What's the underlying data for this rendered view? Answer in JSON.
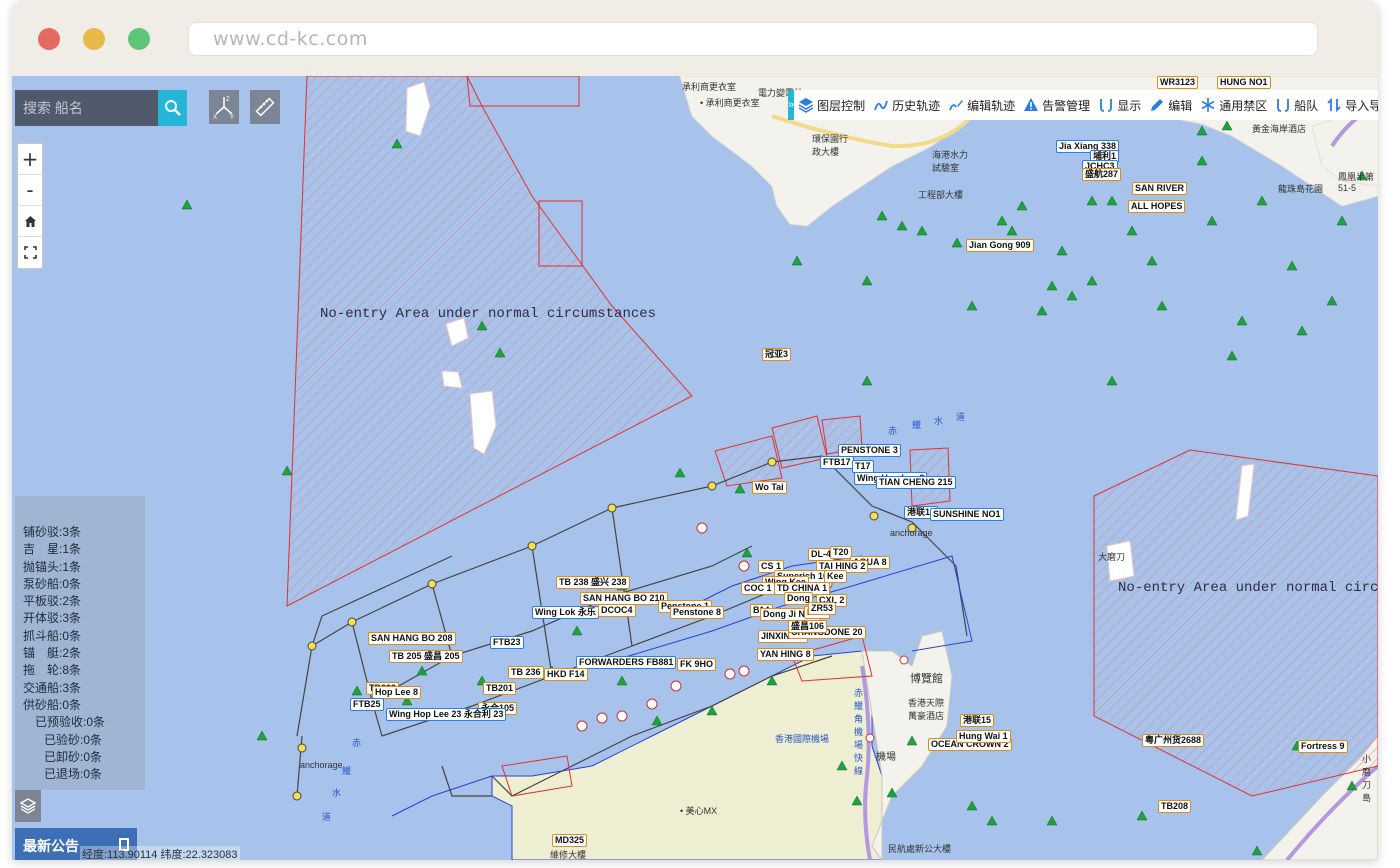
{
  "browser": {
    "url": "www.cd-kc.com"
  },
  "search": {
    "placeholder": "搜索 船名"
  },
  "toolbar": {
    "toggle": "»",
    "items": [
      {
        "label": "图层控制",
        "icon": "layers-icon"
      },
      {
        "label": "历史轨迹",
        "icon": "track-icon"
      },
      {
        "label": "编辑轨迹",
        "icon": "edit-track-icon"
      },
      {
        "label": "告警管理",
        "icon": "warning-icon"
      },
      {
        "label": "显示",
        "icon": "display-icon"
      },
      {
        "label": "编辑",
        "icon": "pencil-icon"
      },
      {
        "label": "通用禁区",
        "icon": "snowflake-icon"
      },
      {
        "label": "船队",
        "icon": "fleet-icon"
      },
      {
        "label": "导入导出",
        "icon": "import-export-icon"
      }
    ]
  },
  "zoom": {
    "plus": "+",
    "minus": "-"
  },
  "stats": [
    {
      "text": "铺砂驳:3条",
      "level": 0
    },
    {
      "text": "吉　星:1条",
      "level": 0
    },
    {
      "text": "抛锚头:1条",
      "level": 0
    },
    {
      "text": "泵砂船:0条",
      "level": 0
    },
    {
      "text": "平板驳:2条",
      "level": 0
    },
    {
      "text": "开体驳:3条",
      "level": 0
    },
    {
      "text": "抓斗船:0条",
      "level": 0
    },
    {
      "text": "锚　艇:2条",
      "level": 0
    },
    {
      "text": "拖　轮:8条",
      "level": 0
    },
    {
      "text": "交通船:3条",
      "level": 0
    },
    {
      "text": "供砂船:0条",
      "level": 0
    },
    {
      "text": "已预验收:0条",
      "level": 1
    },
    {
      "text": "已验砂:0条",
      "level": 2
    },
    {
      "text": "已卸砂:0条",
      "level": 2
    },
    {
      "text": "已退场:0条",
      "level": 2
    }
  ],
  "notice": {
    "label": "最新公告"
  },
  "coords": {
    "text": "经度:113.90114 纬度:22.323083"
  },
  "areas": {
    "left_title": "No-entry Area under normal circumstances",
    "right_title": "No-entry Area under normal circumstanc"
  },
  "land_labels": [
    "承利商更衣室",
    "• 承利商更衣室",
    "電力變電站",
    "環保園行政大樓",
    "海港水力試驗室",
    "工程部大樓",
    "黃金海岸酒店",
    "龍珠島花園",
    "鳳凰半第51-5",
    "香港國際機場",
    "博覽館",
    "香港天際萬豪酒店",
    "機場",
    "• 美心MX",
    "維修大樓",
    "民航處新公大樓",
    "赤鱲角機場快線",
    "大磨刀",
    "小磨刀島",
    "赤",
    "鱲",
    "水",
    "道",
    "赤",
    "鱲",
    "水",
    "道",
    "anchorage",
    "anchorage"
  ],
  "ships": [
    {
      "name": "Jia Xiang 338",
      "color": "#2a7de1"
    },
    {
      "name": "埔利1",
      "color": "#2a7de1"
    },
    {
      "name": "JCHC3",
      "color": "#2a7de1"
    },
    {
      "name": "盛航287",
      "color": "#e08a17"
    },
    {
      "name": "SAN RIVER",
      "color": "#e08a17"
    },
    {
      "name": "ALL HOPES",
      "color": "#e08a17"
    },
    {
      "name": "Jian Gong 909",
      "color": "#e08a17"
    },
    {
      "name": "冠亚3",
      "color": "#e08a17"
    },
    {
      "name": "PENSTONE 3",
      "color": "#2a7de1"
    },
    {
      "name": "FTB17",
      "color": "#2a7de1"
    },
    {
      "name": "T17",
      "color": "#2a7de1"
    },
    {
      "name": "Wing Hop Lee 8",
      "color": "#2a7de1"
    },
    {
      "name": "TIAN CHENG 215",
      "color": "#2a7de1"
    },
    {
      "name": "Wo Tai",
      "color": "#e08a17"
    },
    {
      "name": "港联10",
      "color": "#2a7de1"
    },
    {
      "name": "SUNSHINE NO1",
      "color": "#2a7de1"
    },
    {
      "name": "DL-4",
      "color": "#e08a17"
    },
    {
      "name": "T20",
      "color": "#e08a17"
    },
    {
      "name": "AQUA 8",
      "color": "#e08a17"
    },
    {
      "name": "TAI HING 2",
      "color": "#e08a17"
    },
    {
      "name": "CS 1",
      "color": "#e08a17"
    },
    {
      "name": "Superich 10",
      "color": "#e08a17"
    },
    {
      "name": "Wing Kee",
      "color": "#e08a17"
    },
    {
      "name": "Kee",
      "color": "#e08a17"
    },
    {
      "name": "COC 1",
      "color": "#e08a17"
    },
    {
      "name": "TD CHINA 1",
      "color": "#e08a17"
    },
    {
      "name": "Dong",
      "color": "#e08a17"
    },
    {
      "name": "CXL 2",
      "color": "#e08a17"
    },
    {
      "name": "B14",
      "color": "#e08a17"
    },
    {
      "name": "Dong Ji No.5",
      "color": "#e08a17"
    },
    {
      "name": "No.7",
      "color": "#e08a17"
    },
    {
      "name": "ZR53",
      "color": "#e08a17"
    },
    {
      "name": "TB 238 盛兴 238",
      "color": "#e08a17"
    },
    {
      "name": "SAN HANG BO 210",
      "color": "#e08a17"
    },
    {
      "name": "Wing Lok 永乐",
      "color": "#2a7de1"
    },
    {
      "name": "DCOC4",
      "color": "#e08a17"
    },
    {
      "name": "Penstone 1",
      "color": "#e08a17"
    },
    {
      "name": "Penstone 8",
      "color": "#e08a17"
    },
    {
      "name": "JINXIN707",
      "color": "#e08a17"
    },
    {
      "name": "CHANGDONE 20",
      "color": "#e08a17"
    },
    {
      "name": "盛昌106",
      "color": "#e08a17"
    },
    {
      "name": "SAN HANG BO 208",
      "color": "#e08a17"
    },
    {
      "name": "TB 205 盛昌 205",
      "color": "#e08a17"
    },
    {
      "name": "FTB23",
      "color": "#2a7de1"
    },
    {
      "name": "YAN HING 8",
      "color": "#e08a17"
    },
    {
      "name": "FORWARDERS FB881",
      "color": "#2a7de1"
    },
    {
      "name": "FK 9HO",
      "color": "#e08a17"
    },
    {
      "name": "TB 236",
      "color": "#e08a17"
    },
    {
      "name": "HKD F14",
      "color": "#e08a17"
    },
    {
      "name": "TB233",
      "color": "#e08a17"
    },
    {
      "name": "TB201",
      "color": "#e08a17"
    },
    {
      "name": "Hop Lee 8",
      "color": "#e08a17"
    },
    {
      "name": "FTB25",
      "color": "#2a7de1"
    },
    {
      "name": "永合105",
      "color": "#e08a17"
    },
    {
      "name": "Wing Hop Lee 23 永合利 23",
      "color": "#2a7de1"
    },
    {
      "name": "港联15",
      "color": "#e08a17"
    },
    {
      "name": "OCEAN CROWN 2",
      "color": "#e08a17"
    },
    {
      "name": "Hung Wai 1",
      "color": "#e08a17"
    },
    {
      "name": "粤广州货2688",
      "color": "#e08a17"
    },
    {
      "name": "Fortress 9",
      "color": "#e08a17"
    },
    {
      "name": "TB208",
      "color": "#e08a17"
    },
    {
      "name": "MD325",
      "color": "#e08a17"
    },
    {
      "name": "HUNG NO1",
      "color": "#e08a17"
    },
    {
      "name": "WR3123",
      "color": "#e08a17"
    }
  ]
}
